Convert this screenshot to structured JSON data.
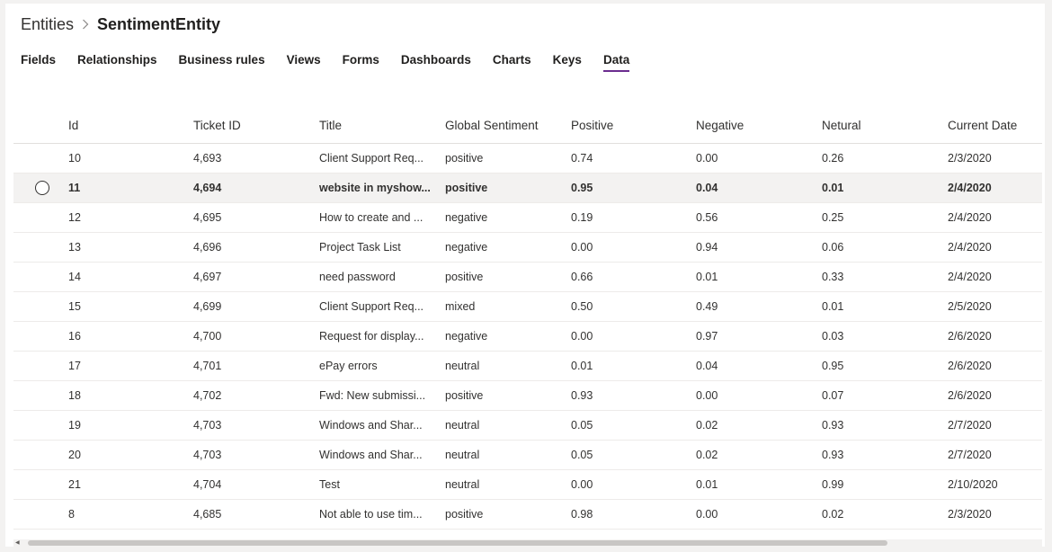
{
  "breadcrumb": {
    "root": "Entities",
    "separator": ">",
    "current": "SentimentEntity"
  },
  "tabs": [
    {
      "label": "Fields",
      "active": false
    },
    {
      "label": "Relationships",
      "active": false
    },
    {
      "label": "Business rules",
      "active": false
    },
    {
      "label": "Views",
      "active": false
    },
    {
      "label": "Forms",
      "active": false
    },
    {
      "label": "Dashboards",
      "active": false
    },
    {
      "label": "Charts",
      "active": false
    },
    {
      "label": "Keys",
      "active": false
    },
    {
      "label": "Data",
      "active": true
    }
  ],
  "accent_color": "#6b2c8f",
  "grid": {
    "columns": [
      "Id",
      "Ticket ID",
      "Title",
      "Global Sentiment",
      "Positive",
      "Negative",
      "Netural",
      "Current Date"
    ],
    "selected_row_index": 1,
    "rows": [
      {
        "id": "10",
        "ticket": "4,693",
        "title": "Client Support Req...",
        "sentiment": "positive",
        "positive": "0.74",
        "negative": "0.00",
        "neutral": "0.26",
        "date": "2/3/2020"
      },
      {
        "id": "11",
        "ticket": "4,694",
        "title": "website in myshow...",
        "sentiment": "positive",
        "positive": "0.95",
        "negative": "0.04",
        "neutral": "0.01",
        "date": "2/4/2020"
      },
      {
        "id": "12",
        "ticket": "4,695",
        "title": "How to create and ...",
        "sentiment": "negative",
        "positive": "0.19",
        "negative": "0.56",
        "neutral": "0.25",
        "date": "2/4/2020"
      },
      {
        "id": "13",
        "ticket": "4,696",
        "title": "Project Task List",
        "sentiment": "negative",
        "positive": "0.00",
        "negative": "0.94",
        "neutral": "0.06",
        "date": "2/4/2020"
      },
      {
        "id": "14",
        "ticket": "4,697",
        "title": "need password",
        "sentiment": "positive",
        "positive": "0.66",
        "negative": "0.01",
        "neutral": "0.33",
        "date": "2/4/2020"
      },
      {
        "id": "15",
        "ticket": "4,699",
        "title": "Client Support Req...",
        "sentiment": "mixed",
        "positive": "0.50",
        "negative": "0.49",
        "neutral": "0.01",
        "date": "2/5/2020"
      },
      {
        "id": "16",
        "ticket": "4,700",
        "title": "Request for display...",
        "sentiment": "negative",
        "positive": "0.00",
        "negative": "0.97",
        "neutral": "0.03",
        "date": "2/6/2020"
      },
      {
        "id": "17",
        "ticket": "4,701",
        "title": "ePay errors",
        "sentiment": "neutral",
        "positive": "0.01",
        "negative": "0.04",
        "neutral": "0.95",
        "date": "2/6/2020"
      },
      {
        "id": "18",
        "ticket": "4,702",
        "title": "Fwd: New submissi...",
        "sentiment": "positive",
        "positive": "0.93",
        "negative": "0.00",
        "neutral": "0.07",
        "date": "2/6/2020"
      },
      {
        "id": "19",
        "ticket": "4,703",
        "title": "Windows and Shar...",
        "sentiment": "neutral",
        "positive": "0.05",
        "negative": "0.02",
        "neutral": "0.93",
        "date": "2/7/2020"
      },
      {
        "id": "20",
        "ticket": "4,703",
        "title": "Windows and Shar...",
        "sentiment": "neutral",
        "positive": "0.05",
        "negative": "0.02",
        "neutral": "0.93",
        "date": "2/7/2020"
      },
      {
        "id": "21",
        "ticket": "4,704",
        "title": "Test",
        "sentiment": "neutral",
        "positive": "0.00",
        "negative": "0.01",
        "neutral": "0.99",
        "date": "2/10/2020"
      },
      {
        "id": "8",
        "ticket": "4,685",
        "title": "Not able to use tim...",
        "sentiment": "positive",
        "positive": "0.98",
        "negative": "0.00",
        "neutral": "0.02",
        "date": "2/3/2020"
      }
    ]
  }
}
